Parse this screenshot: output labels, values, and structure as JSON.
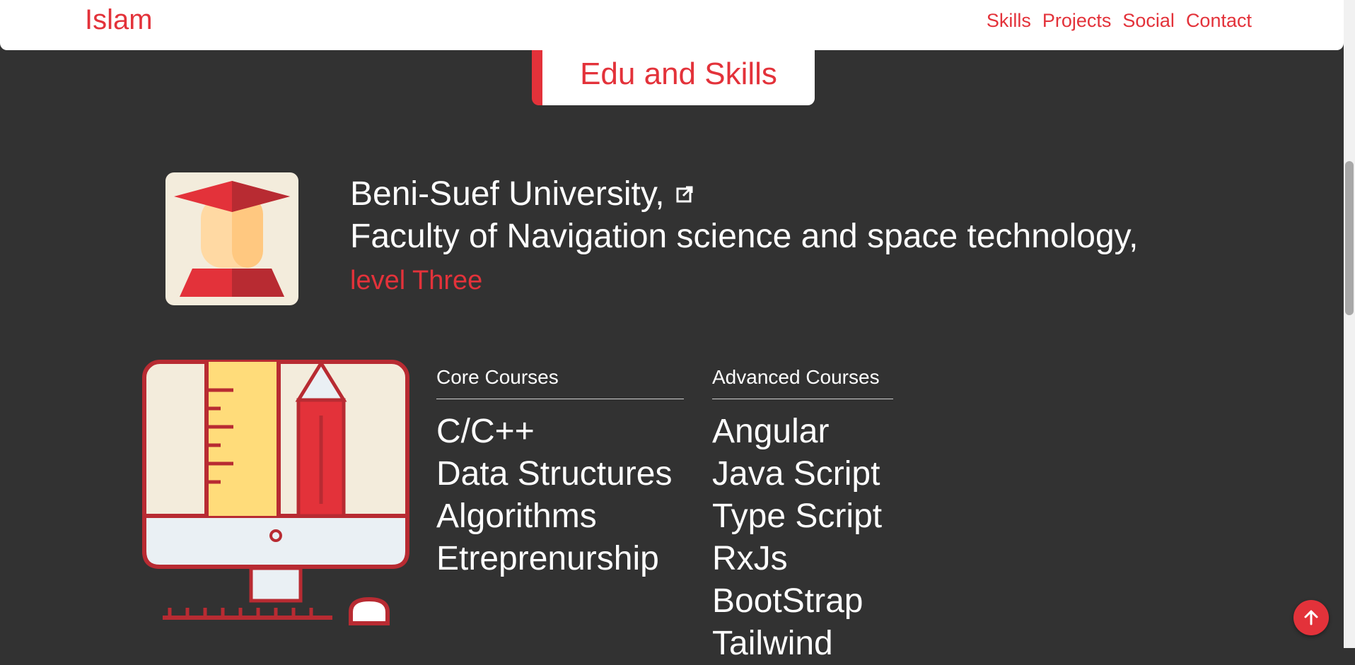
{
  "nav": {
    "brand": "Islam",
    "links": [
      "Skills",
      "Projects",
      "Social",
      "Contact"
    ]
  },
  "section": {
    "title": "Edu and Skills"
  },
  "education": {
    "university": "Beni-Suef University,",
    "faculty": "Faculty of Navigation science and space technology,",
    "level": "level Three",
    "icon": "graduate-icon",
    "link_icon": "external-link-icon"
  },
  "courses": {
    "core": {
      "header": "Core Courses",
      "items": [
        "C/C++",
        "Data Structures",
        "Algorithms",
        "Etreprenurship"
      ]
    },
    "advanced": {
      "header": "Advanced Courses",
      "items": [
        "Angular",
        "Java Script",
        "Type Script",
        "RxJs",
        "BootStrap",
        "Tailwind"
      ]
    }
  },
  "scroll_top_icon": "arrow-up-icon",
  "colors": {
    "accent": "#e3323a",
    "background": "#323232",
    "surface": "#ffffff"
  }
}
